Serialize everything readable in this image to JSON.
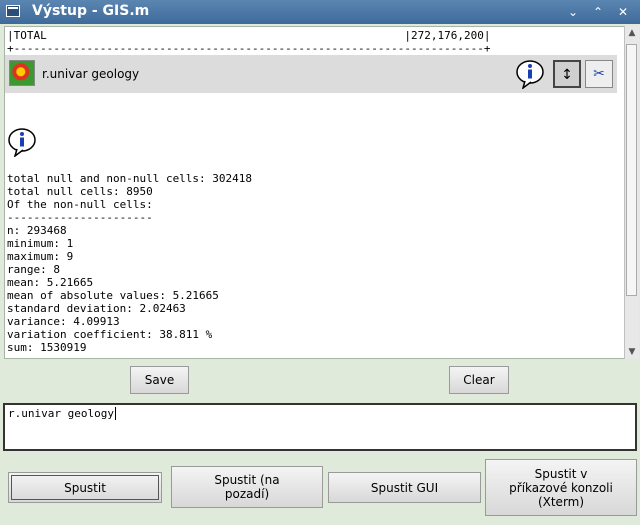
{
  "window": {
    "title": "Výstup - GIS.m",
    "minimize_glyph": "⌄",
    "maximize_glyph": "⌃",
    "close_glyph": "✕"
  },
  "output": {
    "table_line_1": "|TOTAL                                                      |272,176,200|",
    "table_line_2": "+-----------------------------------------------------------------------+",
    "command_label": "r.univar geology",
    "stats": [
      "total null and non-null cells: 302418",
      "total null cells: 8950",
      "Of the non-null cells:",
      "----------------------",
      "n: 293468",
      "minimum: 1",
      "maximum: 9",
      "range: 8",
      "mean: 5.21665",
      "mean of absolute values: 5.21665",
      "standard deviation: 2.02463",
      "variance: 4.09913",
      "variation coefficient: 38.811 %",
      "sum: 1530919"
    ]
  },
  "icons": {
    "info": "info-icon",
    "layer": "raster-layer-icon",
    "expand": "expand-icon",
    "cut": "scissors-icon"
  },
  "buttons": {
    "save": "Save",
    "clear": "Clear",
    "run": "Spustit",
    "run_bg": "Spustit (na pozadí)",
    "run_gui": "Spustit GUI",
    "run_xterm": "Spustit v příkazové konzoli (Xterm)"
  },
  "command_input": {
    "value": "r.univar geology"
  },
  "colors": {
    "titlebar": "#4a76a6",
    "background": "#dfeadb",
    "command_bar": "#dcdcdc"
  }
}
